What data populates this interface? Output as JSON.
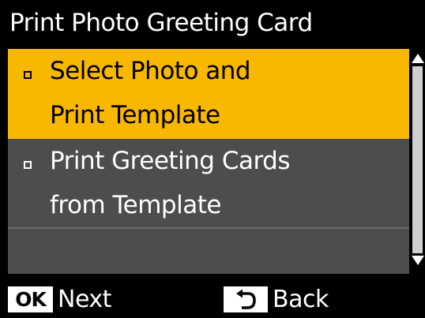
{
  "title": "Print Photo Greeting Card",
  "menu": {
    "items": [
      {
        "line1": "Select Photo and",
        "line2": "Print Template",
        "selected": true
      },
      {
        "line1": "Print Greeting Cards",
        "line2": "from Template",
        "selected": false
      }
    ]
  },
  "footer": {
    "ok_badge": "OK",
    "next_label": "Next",
    "back_label": "Back"
  },
  "colors": {
    "selected_bg": "#f8b800",
    "list_bg": "#4d4d4d",
    "screen_bg": "#000000",
    "text": "#ffffff"
  },
  "icons": {
    "back": "back-arrow-icon",
    "scroll_up": "triangle-up-icon",
    "scroll_down": "triangle-down-icon",
    "bullet": "square-bullet-icon"
  }
}
